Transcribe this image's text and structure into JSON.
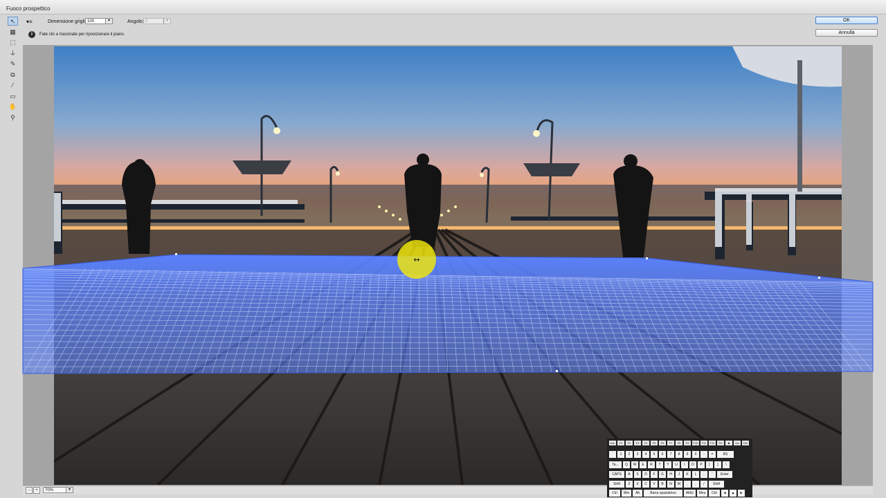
{
  "window": {
    "title": "Fuoco prospettico"
  },
  "options": {
    "grid_size_label": "Dimensione griglia:",
    "grid_size_value": "100",
    "angle_label": "Angolo:",
    "angle_value": "0",
    "hint": "Fate clic e trascinate per riposizionare il piano.",
    "info_icon_glyph": "i"
  },
  "buttons": {
    "ok": "OK",
    "cancel": "Annulla"
  },
  "tools": [
    {
      "name": "edit-plane-tool",
      "glyph": "↖",
      "active": true
    },
    {
      "name": "create-plane-tool",
      "glyph": "▦",
      "active": false
    },
    {
      "name": "marquee-tool",
      "glyph": "⬚",
      "active": false
    },
    {
      "name": "stamp-tool",
      "glyph": "⏚",
      "active": false
    },
    {
      "name": "brush-tool",
      "glyph": "✎",
      "active": false
    },
    {
      "name": "transform-tool",
      "glyph": "⧉",
      "active": false
    },
    {
      "name": "eyedropper-tool",
      "glyph": "⁄",
      "active": false
    },
    {
      "name": "measure-tool",
      "glyph": "▭",
      "active": false
    },
    {
      "name": "hand-tool",
      "glyph": "✋",
      "active": false
    },
    {
      "name": "zoom-tool",
      "glyph": "⚲",
      "active": false
    }
  ],
  "status": {
    "zoom": "70%"
  },
  "keyboard": {
    "rows": [
      [
        "Esc",
        "F1",
        "F2",
        "F3",
        "F4",
        "F5",
        "F6",
        "F7",
        "F8",
        "F9",
        "F10",
        "F11",
        "F12",
        "Prt",
        "■",
        "Ins",
        "Del"
      ],
      [
        "`",
        "1",
        "2",
        "3",
        "4",
        "5",
        "6",
        "7",
        "8",
        "9",
        "0",
        "-",
        "=",
        "BS"
      ],
      [
        "Ta...",
        "Q",
        "W",
        "E",
        "R",
        "T",
        "Y",
        "U",
        "I",
        "O",
        "P",
        "[",
        "]",
        "\\"
      ],
      [
        "CAPS",
        "A",
        "S",
        "D",
        "F",
        "G",
        "H",
        "J",
        "K",
        "L",
        ";",
        "'",
        "Enter"
      ],
      [
        "Shift",
        "Z",
        "X",
        "C",
        "V",
        "B",
        "N",
        "M",
        ",",
        ".",
        "/",
        "Shift"
      ],
      [
        "Ctrl",
        "Win",
        "Alt",
        "Barra spaziatrice",
        "AltGr",
        "Mnu",
        "Ctrl",
        "◄",
        "▲",
        "►"
      ]
    ]
  },
  "colors": {
    "plane_fill": "#5a82ff",
    "grid_line": "#cfdaff",
    "pointer_highlight": "#f2e80a"
  }
}
